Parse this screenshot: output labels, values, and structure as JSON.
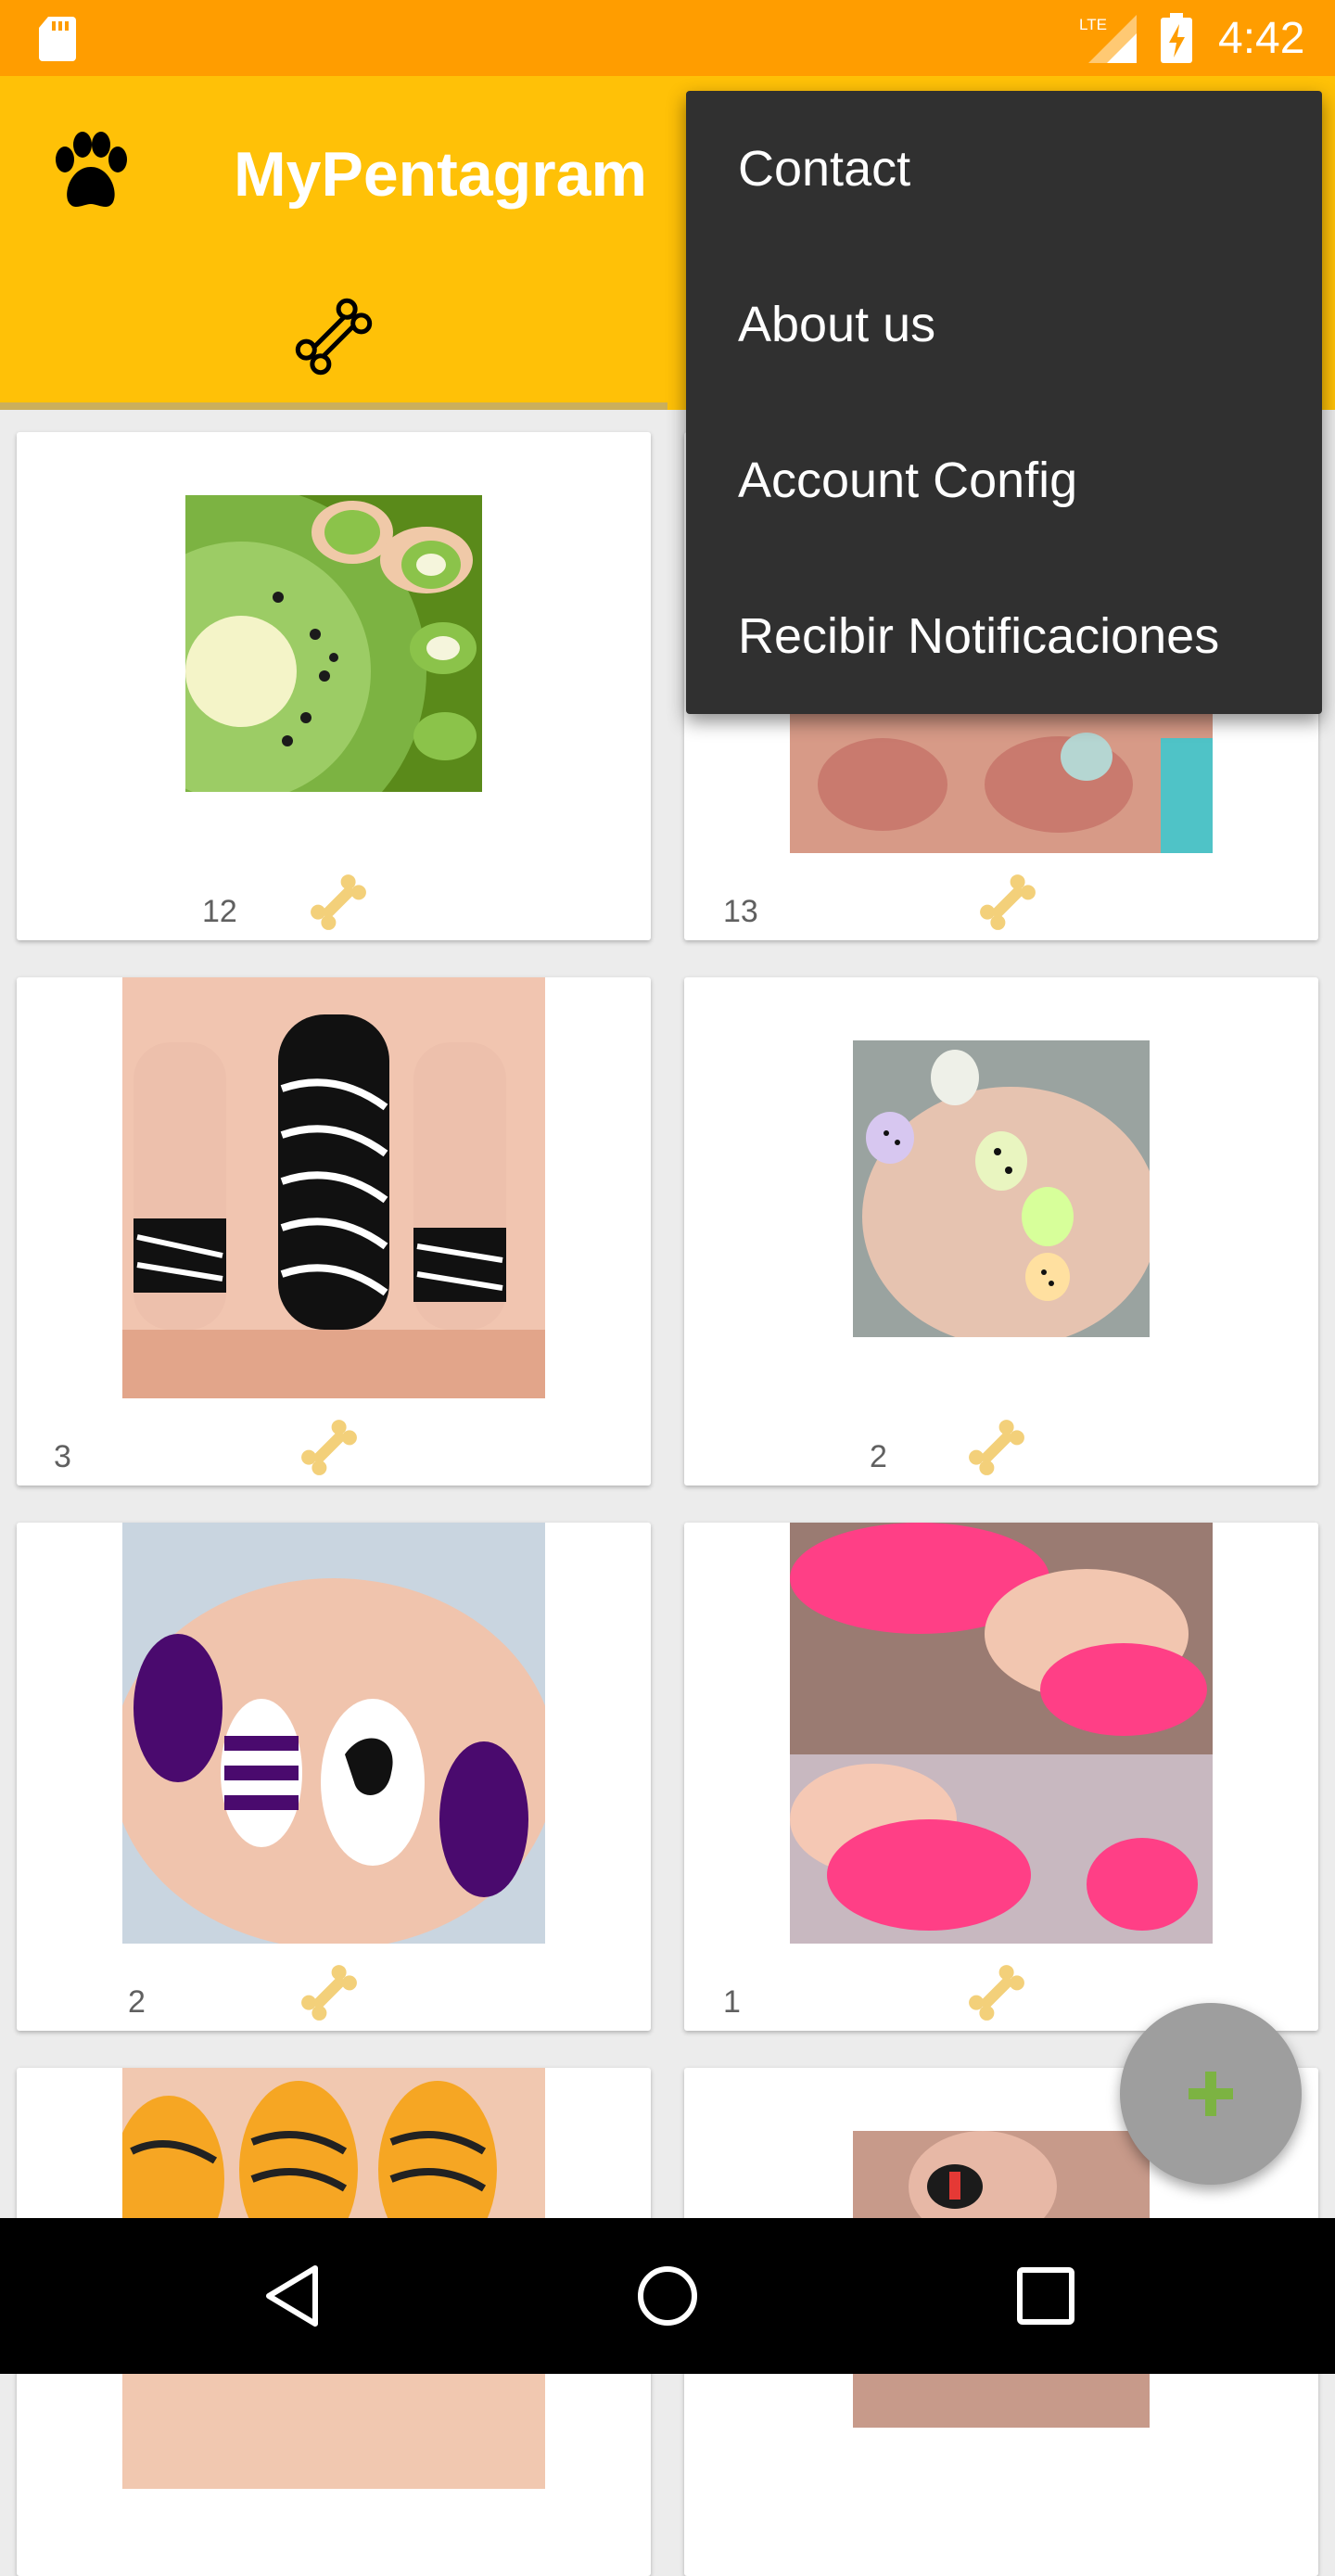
{
  "status_bar": {
    "time": "4:42",
    "network": "LTE",
    "icons": [
      "sd-card-icon",
      "lte-signal-icon",
      "battery-charging-icon"
    ]
  },
  "app_bar": {
    "title": "MyPentagram",
    "logo_icon": "paw-icon",
    "tab_icon": "bone-icon",
    "background_color": "#ffc107"
  },
  "overflow_menu": {
    "items": [
      {
        "label": "Contact"
      },
      {
        "label": "About us"
      },
      {
        "label": "Account Config"
      },
      {
        "label": "Recibir Notificaciones"
      }
    ]
  },
  "feed": {
    "like_icon": "bone-icon",
    "posts": [
      {
        "image": "kiwi-nails",
        "likes": "12"
      },
      {
        "image": "pink-nails",
        "likes": "13"
      },
      {
        "image": "zebra-nails",
        "likes": "3"
      },
      {
        "image": "neon-pattern-nails",
        "likes": "2"
      },
      {
        "image": "purple-rose-nails",
        "likes": "2"
      },
      {
        "image": "pink-glitter-nails",
        "likes": "1"
      },
      {
        "image": "tiger-nails",
        "likes": ""
      },
      {
        "image": "red-nails",
        "likes": ""
      }
    ]
  },
  "fab": {
    "icon": "plus-icon",
    "color": "#7cb342"
  },
  "nav_bar": {
    "icons": [
      "back-icon",
      "home-icon",
      "recent-apps-icon"
    ]
  }
}
